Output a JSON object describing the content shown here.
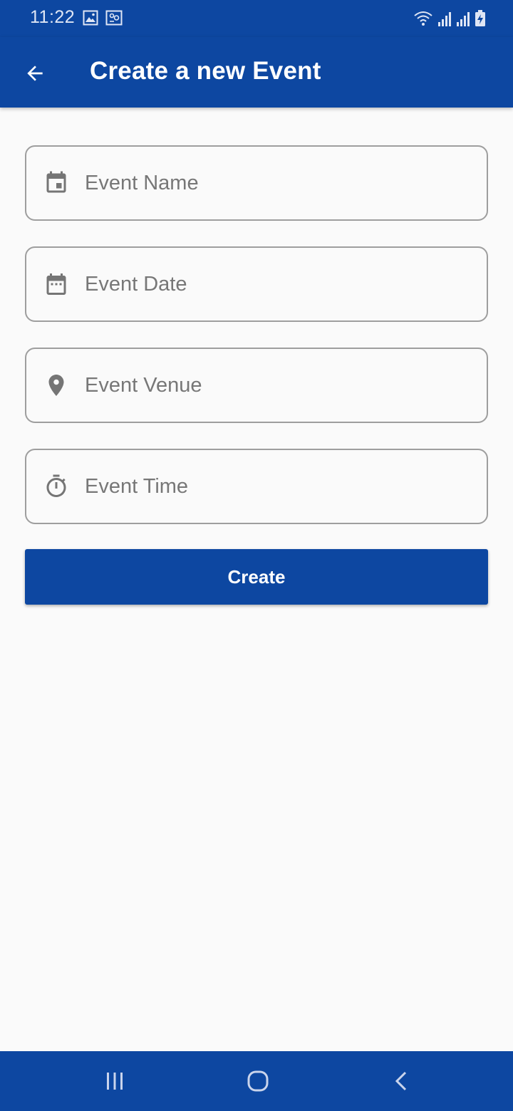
{
  "status_bar": {
    "time": "11:22",
    "left_icons": [
      "image-icon",
      "screen-record-icon"
    ],
    "right_icons": [
      "wifi-icon",
      "signal-icon",
      "signal-icon",
      "battery-charging-icon"
    ]
  },
  "app_bar": {
    "back_icon": "arrow-back-icon",
    "title": "Create a new Event"
  },
  "form": {
    "fields": [
      {
        "icon": "event-icon",
        "placeholder": "Event Name",
        "value": ""
      },
      {
        "icon": "calendar-month-icon",
        "placeholder": "Event Date",
        "value": ""
      },
      {
        "icon": "location-pin-icon",
        "placeholder": "Event Venue",
        "value": ""
      },
      {
        "icon": "timer-icon",
        "placeholder": "Event Time",
        "value": ""
      }
    ],
    "submit_label": "Create"
  },
  "nav_bar": {
    "buttons": [
      "recent-apps-icon",
      "home-icon",
      "back-icon"
    ]
  },
  "colors": {
    "primary": "#0d47a1",
    "background": "#fafafa",
    "field_border": "#9e9e9e",
    "icon_gray": "#757575"
  }
}
